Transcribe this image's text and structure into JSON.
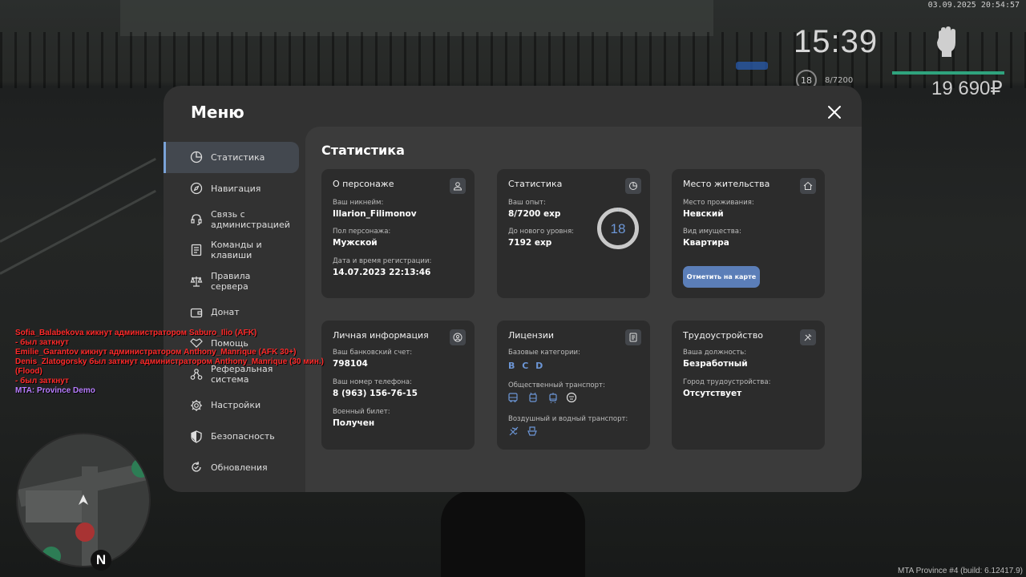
{
  "hud": {
    "datetime": "03.09.2025 20:54:57",
    "clock": "15:39",
    "level": "18",
    "exp": "8/7200",
    "money": "19 690₽"
  },
  "chat": [
    {
      "text": "Sofia_Balabekova кикнут администратором Saburo_Ilio (AFK)",
      "color": "red"
    },
    {
      "text": "- был заткнут",
      "color": "red"
    },
    {
      "text": "Emilie_Garantov кикнут администратором Anthony_Manrique (AFK 30+)",
      "color": "red"
    },
    {
      "text": "Denis_Zlatogorsky был заткнут администратором Anthony_Manrique (30 мин.)",
      "color": "red"
    },
    {
      "text": "(Flood)",
      "color": "red"
    },
    {
      "text": "- был заткнут",
      "color": "red"
    },
    {
      "text": "MTA: Province Demo",
      "color": "purple"
    }
  ],
  "footer": "MTA Province #4 (build: 6.12417.9)",
  "menu": {
    "title": "Меню",
    "nav": [
      {
        "label": "Статистика",
        "icon": "pie-chart-icon",
        "active": true
      },
      {
        "label": "Навигация",
        "icon": "compass-icon",
        "active": false
      },
      {
        "label": "Связь с администрацией",
        "icon": "headset-icon",
        "active": false
      },
      {
        "label": "Команды и клавиши",
        "icon": "document-list-icon",
        "active": false
      },
      {
        "label": "Правила сервера",
        "icon": "scales-icon",
        "active": false
      },
      {
        "label": "Донат",
        "icon": "wallet-icon",
        "active": false
      },
      {
        "label": "Помощь",
        "icon": "handshake-icon",
        "active": false
      },
      {
        "label": "Реферальная система",
        "icon": "referral-network-icon",
        "active": false
      },
      {
        "label": "Настройки",
        "icon": "gear-icon",
        "active": false
      },
      {
        "label": "Безопасность",
        "icon": "shield-icon",
        "active": false
      },
      {
        "label": "Обновления",
        "icon": "refresh-icon",
        "active": false
      }
    ]
  },
  "content": {
    "title": "Статистика",
    "character": {
      "title": "О персонаже",
      "nickname_label": "Ваш никнейм:",
      "nickname": "Illarion_Filimonov",
      "gender_label": "Пол персонажа:",
      "gender": "Мужской",
      "reg_label": "Дата и время регистрации:",
      "reg": "14.07.2023 22:13:46"
    },
    "stats": {
      "title": "Статистика",
      "exp_label": "Ваш опыт:",
      "exp": "8/7200 exp",
      "next_label": "До нового уровня:",
      "next": "7192 exp",
      "level": "18",
      "level_progress": 0.0011
    },
    "residence": {
      "title": "Место жительства",
      "place_label": "Место проживания:",
      "place": "Невский",
      "property_label": "Вид имущества:",
      "property": "Квартира",
      "button": "Отметить на карте"
    },
    "personal": {
      "title": "Личная информация",
      "bank_label": "Ваш банковский счет:",
      "bank": "798104",
      "phone_label": "Ваш номер телефона:",
      "phone": "8 (963) 156-76-15",
      "military_label": "Военный билет:",
      "military": "Получен"
    },
    "licenses": {
      "title": "Лицензии",
      "base_label": "Базовые категории:",
      "base": "B C D",
      "public_label": "Общественный транспорт:",
      "air_label": "Воздушный и водный транспорт:"
    },
    "employment": {
      "title": "Трудоустройство",
      "position_label": "Ваша должность:",
      "position": "Безработный",
      "city_label": "Город трудоустройства:",
      "city": "Отсутствует"
    }
  }
}
